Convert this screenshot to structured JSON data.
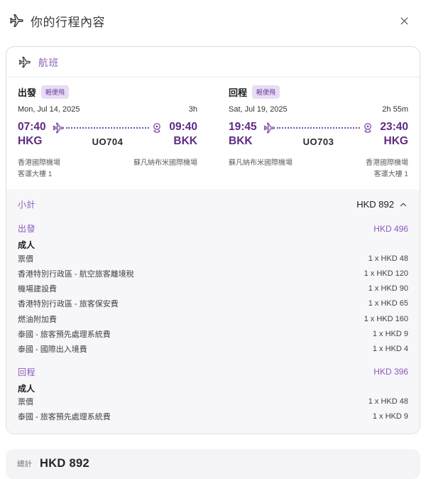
{
  "colors": {
    "accent_dark_purple": "#5e2b84",
    "accent_purple": "#8b5cb8",
    "badge_bg": "#e8dcf4",
    "badge_text": "#6b3899",
    "breakdown_bg": "#f7f6f9",
    "total_bar_bg": "#f4f4f6"
  },
  "icons": {
    "header_plane": "plane-icon",
    "close": "close-icon",
    "route_plane": "plane-icon",
    "route_pin": "location-pin-icon",
    "subtotal_chevron": "chevron-up-icon"
  },
  "header": {
    "title": "你的行程內容"
  },
  "flights": {
    "section_title": "航班",
    "legs": [
      {
        "direction_label": "出發",
        "fare_badge": "輕便飛",
        "date": "Mon, Jul 14, 2025",
        "duration": "3h",
        "dep_time": "07:40",
        "dep_code": "HKG",
        "arr_time": "09:40",
        "arr_code": "BKK",
        "flight_number": "UO704",
        "dep_airport": "香港國際機場",
        "dep_terminal": "客運大樓 1",
        "arr_airport": "蘇凡納布米國際機場",
        "arr_terminal": ""
      },
      {
        "direction_label": "回程",
        "fare_badge": "輕便飛",
        "date": "Sat, Jul 19, 2025",
        "duration": "2h 55m",
        "dep_time": "19:45",
        "dep_code": "BKK",
        "arr_time": "23:40",
        "arr_code": "HKG",
        "flight_number": "UO703",
        "dep_airport": "蘇凡納布米國際機場",
        "dep_terminal": "",
        "arr_airport": "香港國際機場",
        "arr_terminal": "客運大樓 1"
      }
    ]
  },
  "price": {
    "subtotal_label": "小計",
    "subtotal_value": "HKD 892",
    "sections": [
      {
        "label": "出發",
        "total": "HKD 496",
        "pax": "成人",
        "items": [
          {
            "label": "票價",
            "value": "1 x HKD 48"
          },
          {
            "label": "香港特別行政區 - 航空旅客離境稅",
            "value": "1 x HKD 120"
          },
          {
            "label": "機場建設費",
            "value": "1 x HKD 90"
          },
          {
            "label": "香港特別行政區 - 旅客保安費",
            "value": "1 x HKD 65"
          },
          {
            "label": "燃油附加費",
            "value": "1 x HKD 160"
          },
          {
            "label": "泰國 - 旅客預先處理系統費",
            "value": "1 x HKD 9"
          },
          {
            "label": "泰國 - 國際出入境費",
            "value": "1 x HKD 4"
          }
        ]
      },
      {
        "label": "回程",
        "total": "HKD 396",
        "pax": "成人",
        "items": [
          {
            "label": "票價",
            "value": "1 x HKD 48"
          },
          {
            "label": "泰國 - 旅客預先處理系統費",
            "value": "1 x HKD 9"
          }
        ]
      }
    ]
  },
  "total": {
    "label": "總計",
    "value": "HKD 892"
  }
}
